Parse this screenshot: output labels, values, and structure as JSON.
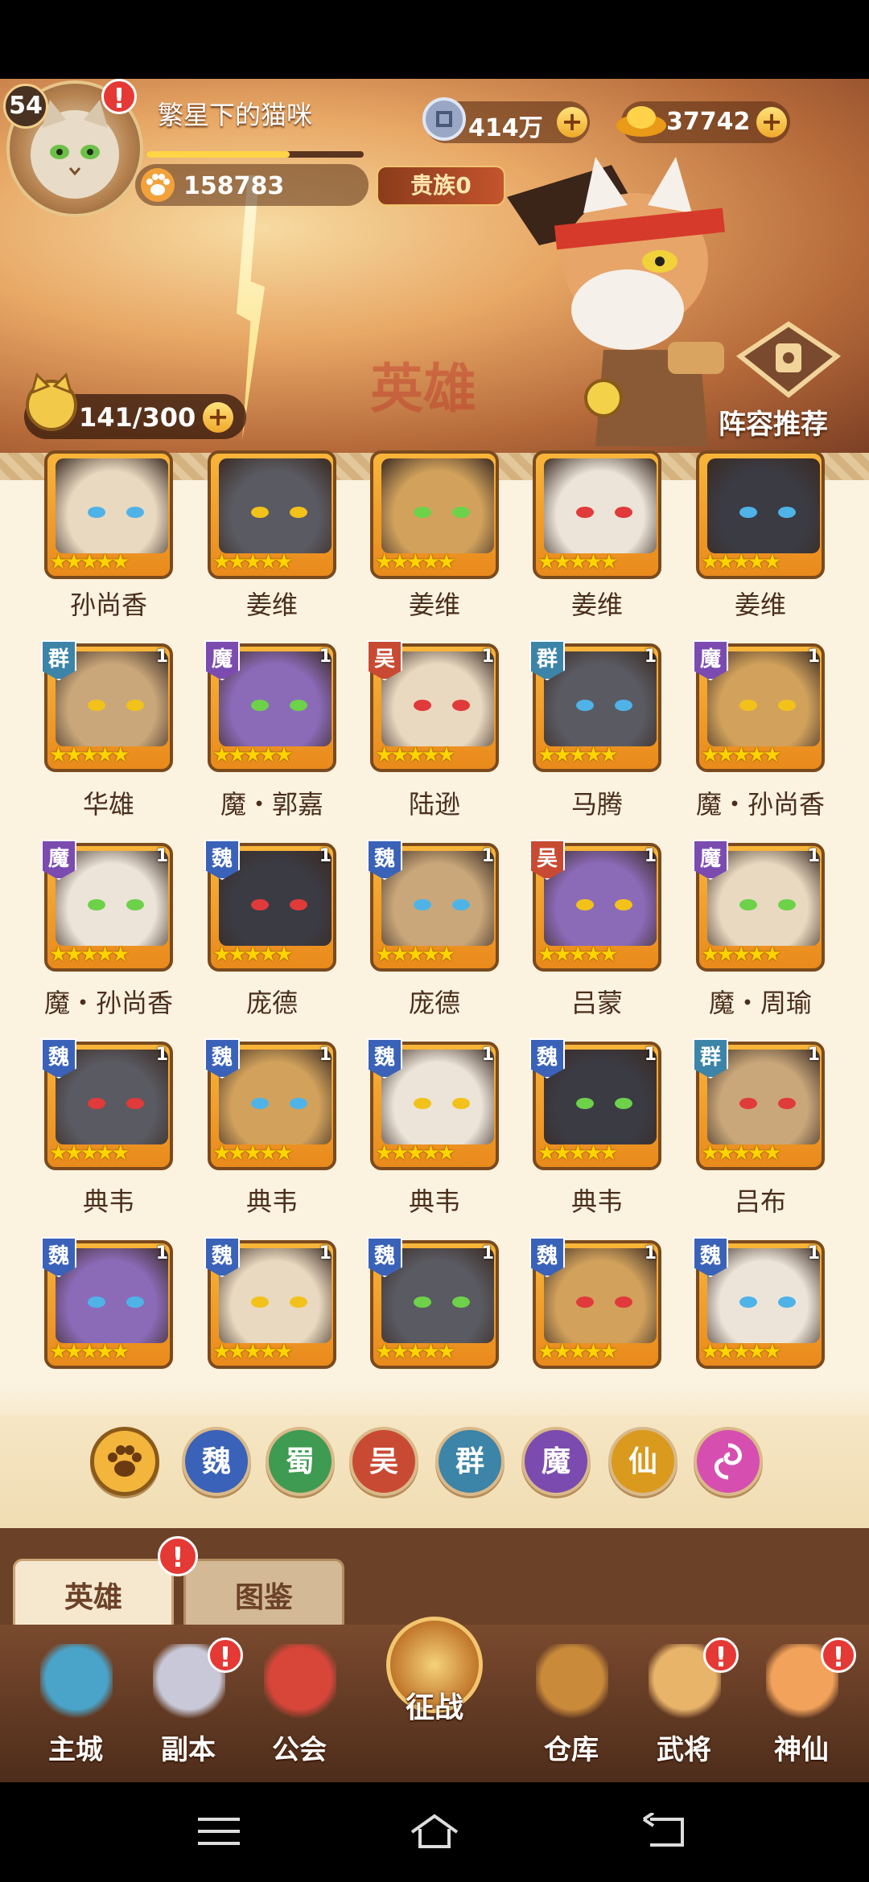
{
  "player": {
    "level": "54",
    "name": "繁星下的猫咪",
    "paw_points": "158783",
    "noble": "贵族0",
    "xp_fraction": 0.66
  },
  "currency": {
    "silver": "414万",
    "gold": "37742"
  },
  "energy": "141/300",
  "banner": {
    "calligraphy": "英雄",
    "formation_label": "阵容推荐"
  },
  "heroes": [
    {
      "name": "孙尚香",
      "faction": "",
      "level": "",
      "stars": 5
    },
    {
      "name": "姜维",
      "faction": "",
      "level": "",
      "stars": 5
    },
    {
      "name": "姜维",
      "faction": "",
      "level": "",
      "stars": 5
    },
    {
      "name": "姜维",
      "faction": "",
      "level": "",
      "stars": 5
    },
    {
      "name": "姜维",
      "faction": "",
      "level": "",
      "stars": 5
    },
    {
      "name": "华雄",
      "faction": "群",
      "level": "1",
      "stars": 5
    },
    {
      "name": "魔・郭嘉",
      "faction": "魔",
      "level": "1",
      "stars": 5
    },
    {
      "name": "陆逊",
      "faction": "吴",
      "level": "1",
      "stars": 5
    },
    {
      "name": "马腾",
      "faction": "群",
      "level": "1",
      "stars": 5
    },
    {
      "name": "魔・孙尚香",
      "faction": "魔",
      "level": "1",
      "stars": 5
    },
    {
      "name": "魔・孙尚香",
      "faction": "魔",
      "level": "1",
      "stars": 5
    },
    {
      "name": "庞德",
      "faction": "魏",
      "level": "1",
      "stars": 5
    },
    {
      "name": "庞德",
      "faction": "魏",
      "level": "1",
      "stars": 5
    },
    {
      "name": "吕蒙",
      "faction": "吴",
      "level": "1",
      "stars": 5
    },
    {
      "name": "魔・周瑜",
      "faction": "魔",
      "level": "1",
      "stars": 5
    },
    {
      "name": "典韦",
      "faction": "魏",
      "level": "1",
      "stars": 5
    },
    {
      "name": "典韦",
      "faction": "魏",
      "level": "1",
      "stars": 5
    },
    {
      "name": "典韦",
      "faction": "魏",
      "level": "1",
      "stars": 5
    },
    {
      "name": "典韦",
      "faction": "魏",
      "level": "1",
      "stars": 5
    },
    {
      "name": "吕布",
      "faction": "群",
      "level": "1",
      "stars": 5
    },
    {
      "name": "",
      "faction": "魏",
      "level": "1",
      "stars": 5
    },
    {
      "name": "",
      "faction": "魏",
      "level": "1",
      "stars": 5
    },
    {
      "name": "",
      "faction": "魏",
      "level": "1",
      "stars": 5
    },
    {
      "name": "",
      "faction": "魏",
      "level": "1",
      "stars": 5
    },
    {
      "name": "",
      "faction": "魏",
      "level": "1",
      "stars": 5
    }
  ],
  "faction_colors": {
    "魏": "#3a62b8",
    "蜀": "#3f9a52",
    "吴": "#c94a33",
    "群": "#3c84a8",
    "魔": "#7b4bb0",
    "仙": "#d99a1e"
  },
  "filters": [
    {
      "label": "",
      "icon": "paw-icon",
      "color": "#f3b53b"
    },
    {
      "label": "魏",
      "color": "#3a62b8"
    },
    {
      "label": "蜀",
      "color": "#3f9a52"
    },
    {
      "label": "吴",
      "color": "#c94a33"
    },
    {
      "label": "群",
      "color": "#3c84a8"
    },
    {
      "label": "魔",
      "color": "#7b4bb0"
    },
    {
      "label": "仙",
      "color": "#d99a1e"
    },
    {
      "label": "",
      "icon": "swirl-icon",
      "color": "#d64fb0"
    }
  ],
  "tabs": {
    "hero": "英雄",
    "book": "图鉴"
  },
  "nav": [
    {
      "label": "主城",
      "icon": "castle-icon",
      "alert": false
    },
    {
      "label": "副本",
      "icon": "sword-icon",
      "alert": true
    },
    {
      "label": "公会",
      "icon": "flag-icon",
      "alert": false
    },
    {
      "label": "征战",
      "icon": "battle-icon",
      "alert": false
    },
    {
      "label": "仓库",
      "icon": "bag-icon",
      "alert": false
    },
    {
      "label": "武将",
      "icon": "general-icon",
      "alert": true
    },
    {
      "label": "神仙",
      "icon": "immortal-icon",
      "alert": true
    }
  ],
  "alert_glyph": "!"
}
